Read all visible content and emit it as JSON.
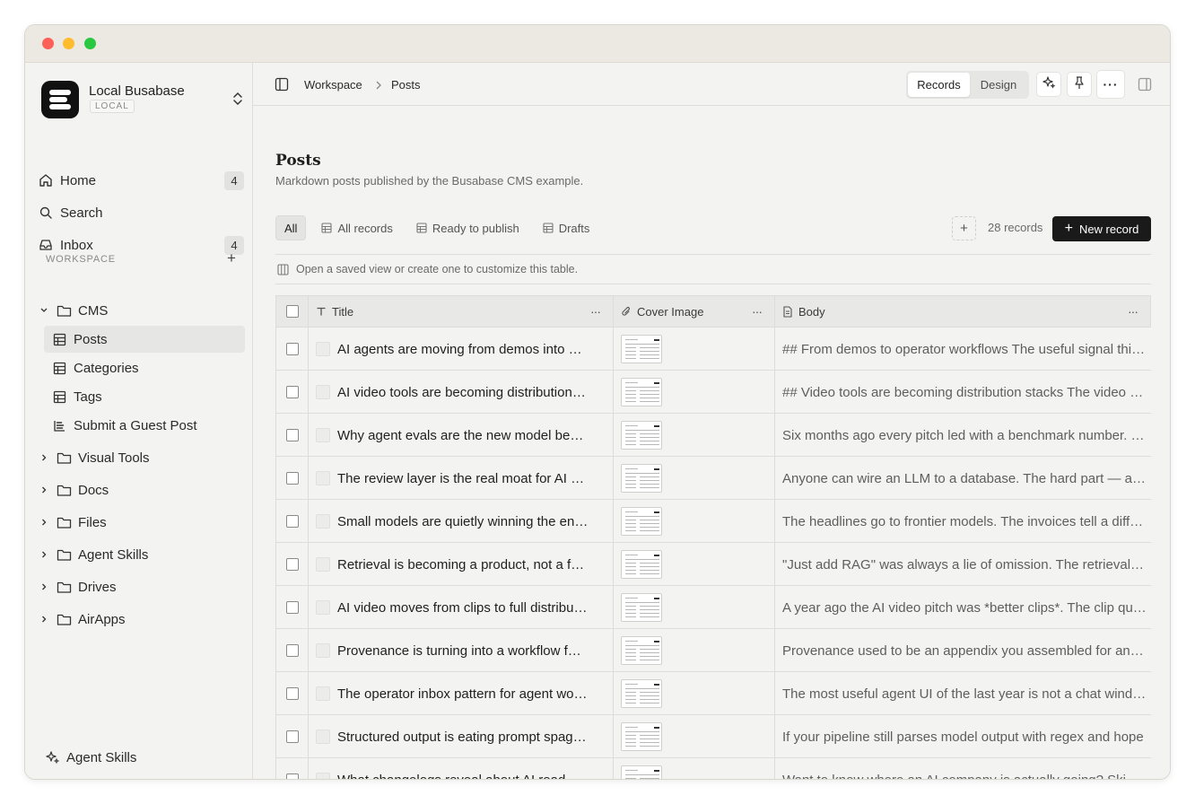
{
  "window": {
    "controls": [
      "close",
      "minimize",
      "maximize"
    ]
  },
  "sidebar": {
    "workspace": {
      "name": "Local Busabase",
      "badge": "LOCAL"
    },
    "nav": [
      {
        "label": "Home",
        "icon": "home-icon",
        "count": "4"
      },
      {
        "label": "Search",
        "icon": "search-icon",
        "count": ""
      },
      {
        "label": "Inbox",
        "icon": "inbox-icon",
        "count": "4"
      }
    ],
    "section_label": "WORKSPACE",
    "tree": [
      {
        "label": "CMS",
        "icon": "folder-icon",
        "expanded": true,
        "children": [
          {
            "label": "Posts",
            "icon": "table-icon",
            "active": true
          },
          {
            "label": "Categories",
            "icon": "table-icon"
          },
          {
            "label": "Tags",
            "icon": "table-icon"
          },
          {
            "label": "Submit a Guest Post",
            "icon": "form-icon"
          }
        ]
      },
      {
        "label": "Visual Tools",
        "icon": "folder-icon",
        "expanded": false
      },
      {
        "label": "Docs",
        "icon": "folder-icon",
        "expanded": false
      },
      {
        "label": "Files",
        "icon": "folder-icon",
        "expanded": false
      },
      {
        "label": "Agent Skills",
        "icon": "folder-icon",
        "expanded": false
      },
      {
        "label": "Drives",
        "icon": "folder-icon",
        "expanded": false
      },
      {
        "label": "AirApps",
        "icon": "folder-icon",
        "expanded": false
      }
    ],
    "bottom_link": "Agent Skills"
  },
  "topbar": {
    "breadcrumb": [
      "Workspace",
      "Posts"
    ],
    "mode_tabs": [
      "Records",
      "Design"
    ],
    "active_mode": "Records"
  },
  "page": {
    "title": "Posts",
    "description": "Markdown posts published by the Busabase CMS example."
  },
  "views": {
    "tabs": [
      "All",
      "All records",
      "Ready to publish",
      "Drafts"
    ],
    "active": "All",
    "record_count": "28 records",
    "new_record_label": "New record",
    "hint": "Open a saved view or create one to customize this table."
  },
  "table": {
    "columns": [
      {
        "label": "Title",
        "icon": "text-type-icon"
      },
      {
        "label": "Cover Image",
        "icon": "paperclip-icon"
      },
      {
        "label": "Body",
        "icon": "document-icon"
      }
    ],
    "rows": [
      {
        "title": "AI agents are moving from demos into operator workflows",
        "body": "## From demos to operator workflows The useful signal this year"
      },
      {
        "title": "AI video tools are becoming distribution stacks",
        "body": "## Video tools are becoming distribution stacks The video pitch"
      },
      {
        "title": "Why agent evals are the new model benchmark",
        "body": "Six months ago every pitch led with a benchmark number. Now"
      },
      {
        "title": "The review layer is the real moat for AI apps",
        "body": "Anyone can wire an LLM to a database. The hard part — and the moat"
      },
      {
        "title": "Small models are quietly winning the enterprise",
        "body": "The headlines go to frontier models. The invoices tell a different story"
      },
      {
        "title": "Retrieval is becoming a product, not a feature",
        "body": "\"Just add RAG\" was always a lie of omission. The retrieval layer"
      },
      {
        "title": "AI video moves from clips to full distribution",
        "body": "A year ago the AI video pitch was *better clips*. The clip quality"
      },
      {
        "title": "Provenance is turning into a workflow feature",
        "body": "Provenance used to be an appendix you assembled for an audit"
      },
      {
        "title": "The operator inbox pattern for agent workflows",
        "body": "The most useful agent UI of the last year is not a chat window"
      },
      {
        "title": "Structured output is eating prompt spaghetti",
        "body": "If your pipeline still parses model output with regex and hope"
      },
      {
        "title": "What changelogs reveal about AI roadmaps",
        "body": "Want to know where an AI company is actually going? Skip the keynote"
      }
    ]
  }
}
